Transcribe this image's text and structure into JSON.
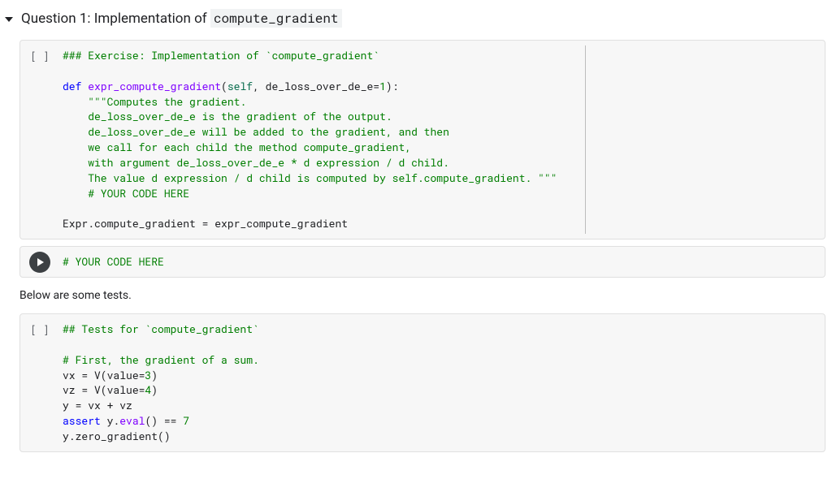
{
  "heading": {
    "prefix": "Question 1: Implementation of ",
    "code": "compute_gradient"
  },
  "cell1": {
    "prompt": "[ ]",
    "code_html": "<span class='tok-com'>### Exercise: Implementation of `compute_gradient`</span>\n\n<span class='tok-kw'>def</span> <span class='tok-fn'>expr_compute_gradient</span>(<span class='tok-self'>self</span>, de_loss_over_de_e=<span class='tok-num'>1</span>):\n    <span class='tok-com'>\"\"\"Computes the gradient.</span>\n<span class='tok-com'>    de_loss_over_de_e is the gradient of the output.</span>\n<span class='tok-com'>    de_loss_over_de_e will be added to the gradient, and then</span>\n<span class='tok-com'>    we call for each child the method compute_gradient,</span>\n<span class='tok-com'>    with argument de_loss_over_de_e * d expression / d child.</span>\n<span class='tok-com'>    The value d expression / d child is computed by self.compute_gradient. \"\"\"</span>\n    <span class='tok-com'># YOUR CODE HERE</span>\n\nExpr.compute_gradient = expr_compute_gradient"
  },
  "cell2": {
    "code_html": "<span class='tok-com'># YOUR CODE HERE</span>"
  },
  "between_text": "Below are some tests.",
  "cell3": {
    "prompt": "[ ]",
    "code_html": "<span class='tok-com'>## Tests for `compute_gradient`</span>\n\n<span class='tok-com'># First, the gradient of a sum.</span>\nvx = V(value=<span class='tok-num'>3</span>)\nvz = V(value=<span class='tok-num'>4</span>)\ny = vx + vz\n<span class='tok-kw'>assert</span> y.<span class='tok-fn'>eval</span>() == <span class='tok-num'>7</span>\ny.zero_gradient()"
  }
}
